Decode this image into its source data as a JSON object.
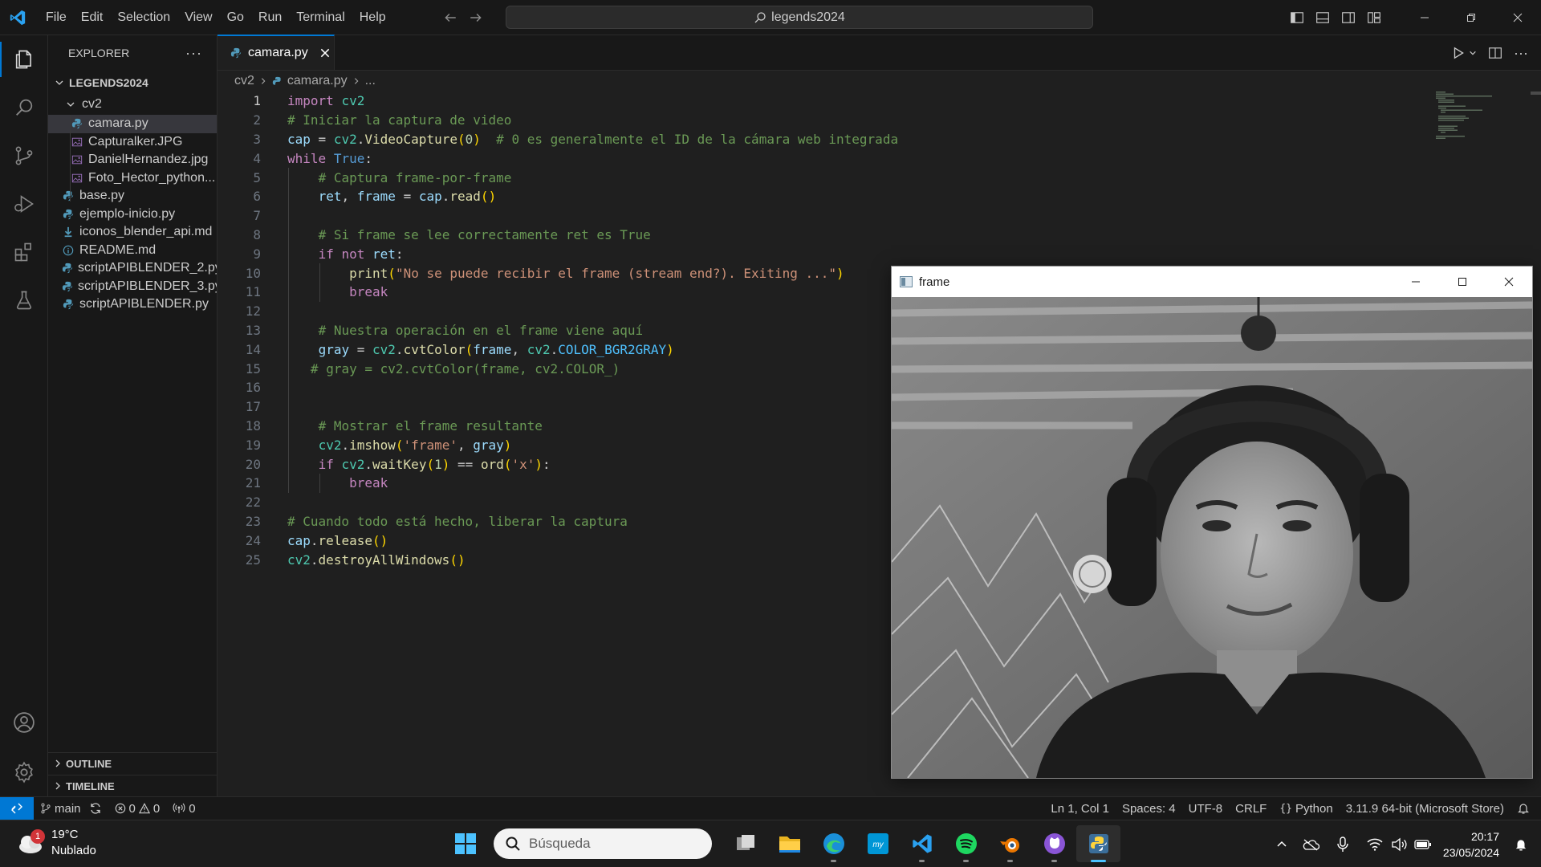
{
  "titlebar": {
    "menu": [
      "File",
      "Edit",
      "Selection",
      "View",
      "Go",
      "Run",
      "Terminal",
      "Help"
    ],
    "search_text": "legends2024"
  },
  "sidebar": {
    "title": "EXPLORER",
    "root": "LEGENDS2024",
    "folder": "cv2",
    "items": [
      {
        "label": "camara.py",
        "icon": "python-file-icon",
        "indent": 2,
        "selected": true
      },
      {
        "label": "Capturalker.JPG",
        "icon": "image-file-icon",
        "indent": 2
      },
      {
        "label": "DanielHernandez.jpg",
        "icon": "image-file-icon",
        "indent": 2
      },
      {
        "label": "Foto_Hector_python...",
        "icon": "image-file-icon",
        "indent": 2
      },
      {
        "label": "base.py",
        "icon": "python-file-icon",
        "indent": 1
      },
      {
        "label": "ejemplo-inicio.py",
        "icon": "python-file-icon",
        "indent": 1
      },
      {
        "label": "iconos_blender_api.md",
        "icon": "markdown-file-icon",
        "indent": 1
      },
      {
        "label": "README.md",
        "icon": "info-file-icon",
        "indent": 1
      },
      {
        "label": "scriptAPIBLENDER_2.py",
        "icon": "python-file-icon",
        "indent": 1
      },
      {
        "label": "scriptAPIBLENDER_3.py",
        "icon": "python-file-icon",
        "indent": 1
      },
      {
        "label": "scriptAPIBLENDER.py",
        "icon": "python-file-icon",
        "indent": 1
      }
    ],
    "outline": "OUTLINE",
    "timeline": "TIMELINE"
  },
  "editor": {
    "tab": "camara.py",
    "breadcrumb": [
      "cv2",
      "camara.py",
      "..."
    ],
    "current_line": 1,
    "lines": [
      "import cv2",
      "# Iniciar la captura de video",
      "cap = cv2.VideoCapture(0)  # 0 es generalmente el ID de la cámara web integrada",
      "while True:",
      "    # Captura frame-por-frame",
      "    ret, frame = cap.read()",
      "",
      "    # Si frame se lee correctamente ret es True",
      "    if not ret:",
      "        print(\"No se puede recibir el frame (stream end?). Exiting ...\")",
      "        break",
      "",
      "    # Nuestra operación en el frame viene aquí",
      "    gray = cv2.cvtColor(frame, cv2.COLOR_BGR2GRAY)",
      "   # gray = cv2.cvtColor(frame, cv2.COLOR_)",
      "",
      "",
      "    # Mostrar el frame resultante",
      "    cv2.imshow('frame', gray)",
      "    if cv2.waitKey(1) == ord('x'):",
      "        break",
      "",
      "# Cuando todo está hecho, liberar la captura",
      "cap.release()",
      "cv2.destroyAllWindows()"
    ]
  },
  "frame_window": {
    "title": "frame"
  },
  "statusbar": {
    "branch": "main",
    "errors": "0",
    "warnings": "0",
    "ports": "0",
    "position": "Ln 1, Col 1",
    "spaces": "Spaces: 4",
    "encoding": "UTF-8",
    "eol": "CRLF",
    "language": "Python",
    "interpreter": "3.11.9 64-bit (Microsoft Store)"
  },
  "taskbar": {
    "weather_temp": "19°C",
    "weather_desc": "Nublado",
    "weather_badge": "1",
    "search_placeholder": "Búsqueda",
    "time": "20:17",
    "date": "23/05/2024",
    "apps": [
      "start-icon",
      "task-view-icon",
      "file-explorer-icon",
      "edge-icon",
      "myhp-icon",
      "vscode-icon",
      "spotify-icon",
      "blender-icon",
      "github-desktop-icon",
      "python-icon"
    ]
  },
  "colors": {
    "accent": "#0078d4",
    "background": "#1f1f1f",
    "sidebar": "#181818"
  }
}
